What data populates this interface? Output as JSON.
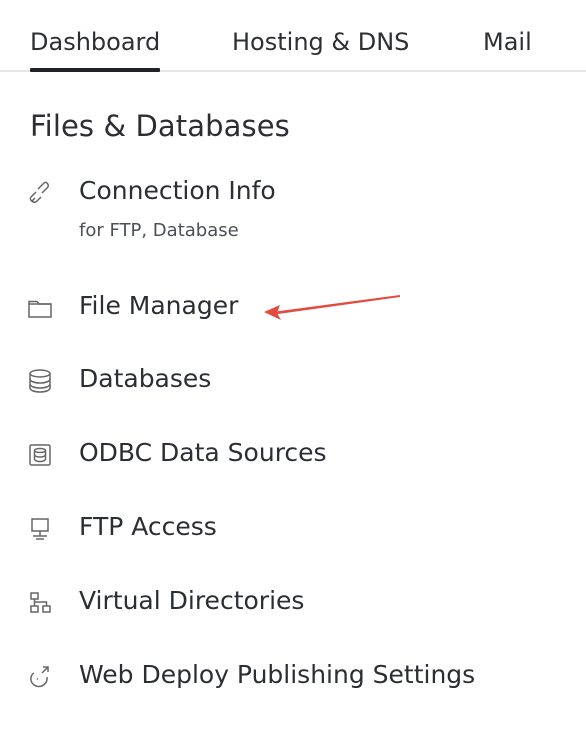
{
  "tabs": [
    {
      "label": "Dashboard",
      "active": true
    },
    {
      "label": "Hosting & DNS",
      "active": false
    },
    {
      "label": "Mail",
      "active": false
    }
  ],
  "section": {
    "title": "Files & Databases"
  },
  "items": [
    {
      "label": "Connection Info",
      "sublabel": "for FTP, Database",
      "icon": "link-icon"
    },
    {
      "label": "File Manager",
      "icon": "folder-icon"
    },
    {
      "label": "Databases",
      "icon": "database-icon"
    },
    {
      "label": "ODBC Data Sources",
      "icon": "odbc-icon"
    },
    {
      "label": "FTP Access",
      "icon": "ftp-icon"
    },
    {
      "label": "Virtual Directories",
      "icon": "directories-icon"
    },
    {
      "label": "Web Deploy Publishing Settings",
      "icon": "web-deploy-icon"
    }
  ],
  "annotation": {
    "arrow_color": "#e34b3f"
  },
  "colors": {
    "text": "#2b2e33",
    "secondary_text": "#4b4f56",
    "divider": "#e6e6e6",
    "active_tab_underline": "#1f2328"
  }
}
